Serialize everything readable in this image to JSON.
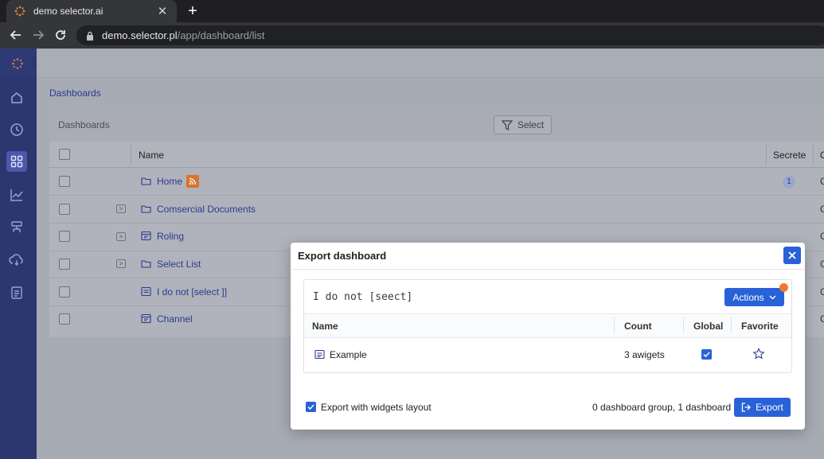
{
  "browser": {
    "tab_title": "demo selector.ai",
    "tab_close": "✕",
    "new_tab": "+",
    "url_host": "demo.selector.pl",
    "url_path": "/app/dashboard/list"
  },
  "page": {
    "breadcrumb": "Dashboards",
    "panel_title": "Dashboards",
    "filter_label": "Select"
  },
  "table": {
    "columns": {
      "name": "Name",
      "secrete": "Secrete",
      "cut": "C"
    },
    "rows": [
      {
        "label": "Home",
        "icon": "folder-icon",
        "badge": "1",
        "cut": "C"
      },
      {
        "label": "Comsercial Documents",
        "icon": "folder-icon",
        "cut": "C"
      },
      {
        "label": "Roling",
        "icon": "dashboard-icon",
        "cut": "C"
      },
      {
        "label": "Select List",
        "icon": "folder-icon",
        "cut": "C"
      },
      {
        "label": "I do not [select ]]",
        "icon": "document-icon",
        "cut": "C"
      },
      {
        "label": "Channel",
        "icon": "dashboard-icon",
        "cut": "C"
      }
    ],
    "expander_glyph": ">"
  },
  "modal": {
    "title": "Export dashboard",
    "item_name": "I do not  [seect]",
    "actions_label": "Actions",
    "columns": {
      "name": "Name",
      "count": "Count",
      "global": "Global",
      "favorite": "Favorite"
    },
    "row": {
      "name": "Example",
      "count": "3 awigets",
      "global": true,
      "favorite": false
    },
    "export_layout_label": "Export with widgets layout",
    "export_layout_checked": true,
    "summary": "0 dashboard group, 1 dashboard",
    "export_label": "Export"
  },
  "colors": {
    "primary": "#2962d6",
    "sidebar": "#2c3770",
    "notify": "#f07a2a",
    "rss": "#d8742f"
  }
}
